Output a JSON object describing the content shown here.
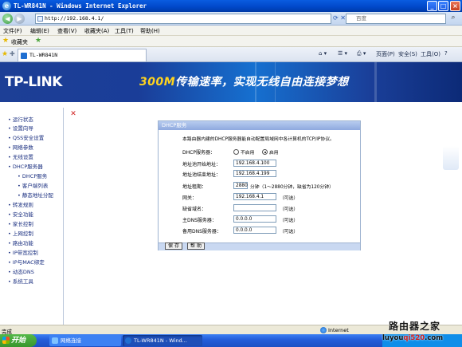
{
  "window": {
    "title": "TL-WR841N - Windows Internet Explorer",
    "controls": {
      "minimize": "_",
      "maximize": "□",
      "close": "×"
    }
  },
  "address_bar": {
    "url": "http://192.168.4.1/",
    "search_placeholder": "百度"
  },
  "menu": [
    "文件(F)",
    "编辑(E)",
    "查看(V)",
    "收藏夹(A)",
    "工具(T)",
    "帮助(H)"
  ],
  "favorites_bar": {
    "label": "收藏夹"
  },
  "tab": {
    "label": "TL-WR841N"
  },
  "toolbar": {
    "page": "页面(P)",
    "safety": "安全(S)",
    "tools": "工具(O)",
    "help": "?"
  },
  "banner": {
    "logo": "TP-LINK",
    "slogan_highlight": "300M",
    "slogan_text": "传输速率，实现无线自由连接梦想"
  },
  "sidebar": {
    "items": [
      {
        "label": "运行状态",
        "sub": false
      },
      {
        "label": "设置向导",
        "sub": false
      },
      {
        "label": "QSS安全设置",
        "sub": false
      },
      {
        "label": "网络参数",
        "sub": false
      },
      {
        "label": "无线设置",
        "sub": false
      },
      {
        "label": "DHCP服务器",
        "sub": false
      },
      {
        "label": "DHCP服务",
        "sub": true
      },
      {
        "label": "客户端列表",
        "sub": true
      },
      {
        "label": "静态地址分配",
        "sub": true
      },
      {
        "label": "转发规则",
        "sub": false
      },
      {
        "label": "安全功能",
        "sub": false
      },
      {
        "label": "家长控制",
        "sub": false
      },
      {
        "label": "上网控制",
        "sub": false
      },
      {
        "label": "路由功能",
        "sub": false
      },
      {
        "label": "IP带宽控制",
        "sub": false
      },
      {
        "label": "IP与MAC绑定",
        "sub": false
      },
      {
        "label": "动态DNS",
        "sub": false
      },
      {
        "label": "系统工具",
        "sub": false
      }
    ]
  },
  "dhcp_panel": {
    "title": "DHCP服务",
    "description": "本路由器内建的DHCP服务器能自动配置局域网中各计算机的TCP/IP协议。",
    "server_label": "DHCP服务器：",
    "option_off": "不启用",
    "option_on": "启用",
    "selected": "启用",
    "start_label": "地址池开始地址：",
    "start_value": "192.168.4.100",
    "end_label": "地址池结束地址：",
    "end_value": "192.168.4.199",
    "lease_label": "地址租期：",
    "lease_value": "2880",
    "lease_hint": "分钟（1～2880分钟，缺省为120分钟）",
    "gateway_label": "网关：",
    "gateway_value": "192.168.4.1",
    "domain_label": "缺省域名：",
    "domain_value": "",
    "dns1_label": "主DNS服务器：",
    "dns1_value": "0.0.0.0",
    "dns2_label": "备用DNS服务器：",
    "dns2_value": "0.0.0.0",
    "optional": "（可选）",
    "save": "保 存",
    "help": "帮 助"
  },
  "status_bar": {
    "left": "完成",
    "zone": "Internet"
  },
  "taskbar": {
    "start": "开始",
    "items": [
      "网络连接",
      "TL-WR841N - Wind..."
    ]
  },
  "watermark": {
    "line1": "路由器之家",
    "line2_a": "luyou",
    "line2_b": "qi520",
    "line2_c": ".com"
  }
}
